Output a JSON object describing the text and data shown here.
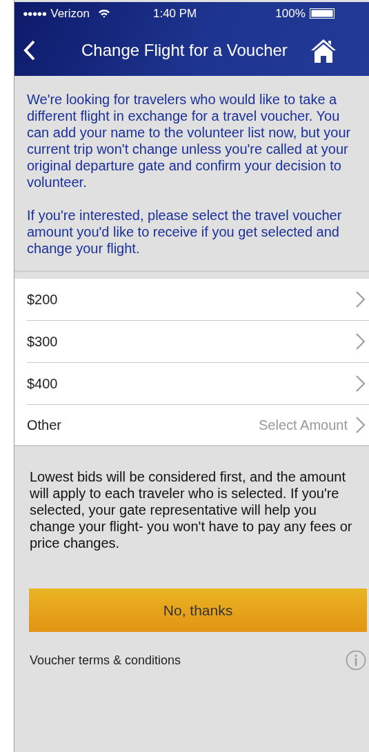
{
  "status_bar": {
    "signal": "●●●●●",
    "carrier": "Verizon",
    "time": "1:40 PM",
    "battery": "100%"
  },
  "nav": {
    "title": "Change Flight for a Voucher"
  },
  "intro": [
    "We're looking for travelers who would like to take a different flight in exchange for a travel voucher.  You can add your name to the volunteer list now, but your current trip won't change unless you're called at your original departure gate and confirm your decision to volunteer.",
    "If you're interested, please select the travel voucher amount you'd like to receive if you get selected and change your flight."
  ],
  "options": [
    {
      "label": "$200"
    },
    {
      "label": "$300"
    },
    {
      "label": "$400"
    },
    {
      "label": "Other",
      "value": "Select Amount"
    }
  ],
  "note": "Lowest bids will be considered first, and the amount will apply to each traveler who is selected. If you're selected, your gate representative will help you change your flight- you won't have to pay any fees or price changes.",
  "button": "No, thanks",
  "terms": "Voucher terms & conditions"
}
